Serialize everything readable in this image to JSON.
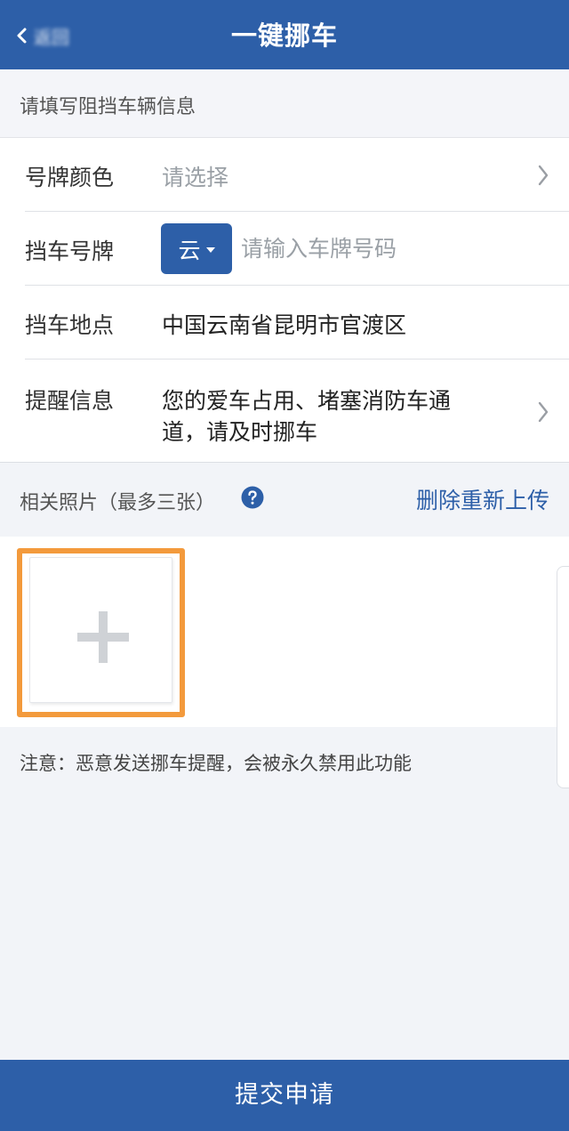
{
  "header": {
    "back_label": "返回",
    "title": "一键挪车"
  },
  "section": {
    "title": "请填写阻挡车辆信息"
  },
  "form": {
    "plate_color": {
      "label": "号牌颜色",
      "placeholder": "请选择"
    },
    "plate_number": {
      "label": "挡车号牌",
      "province": "云",
      "placeholder": "请输入车牌号码"
    },
    "location": {
      "label": "挡车地点",
      "value": "中国云南省昆明市官渡区"
    },
    "message": {
      "label": "提醒信息",
      "line1": "您的爱车占用、堵塞消防车通",
      "line2": "道，请及时挪车"
    }
  },
  "photos": {
    "label": "相关照片（最多三张）",
    "reupload_label": "删除重新上传"
  },
  "notice": "注意：恶意发送挪车提醒，会被永久禁用此功能",
  "submit_label": "提交申请",
  "colors": {
    "primary": "#2d5fa8",
    "upload_highlight": "#f39a3c"
  },
  "icons": [
    "back-arrow-icon",
    "chevron-right-icon",
    "caret-down-icon",
    "help-icon",
    "plus-icon"
  ]
}
